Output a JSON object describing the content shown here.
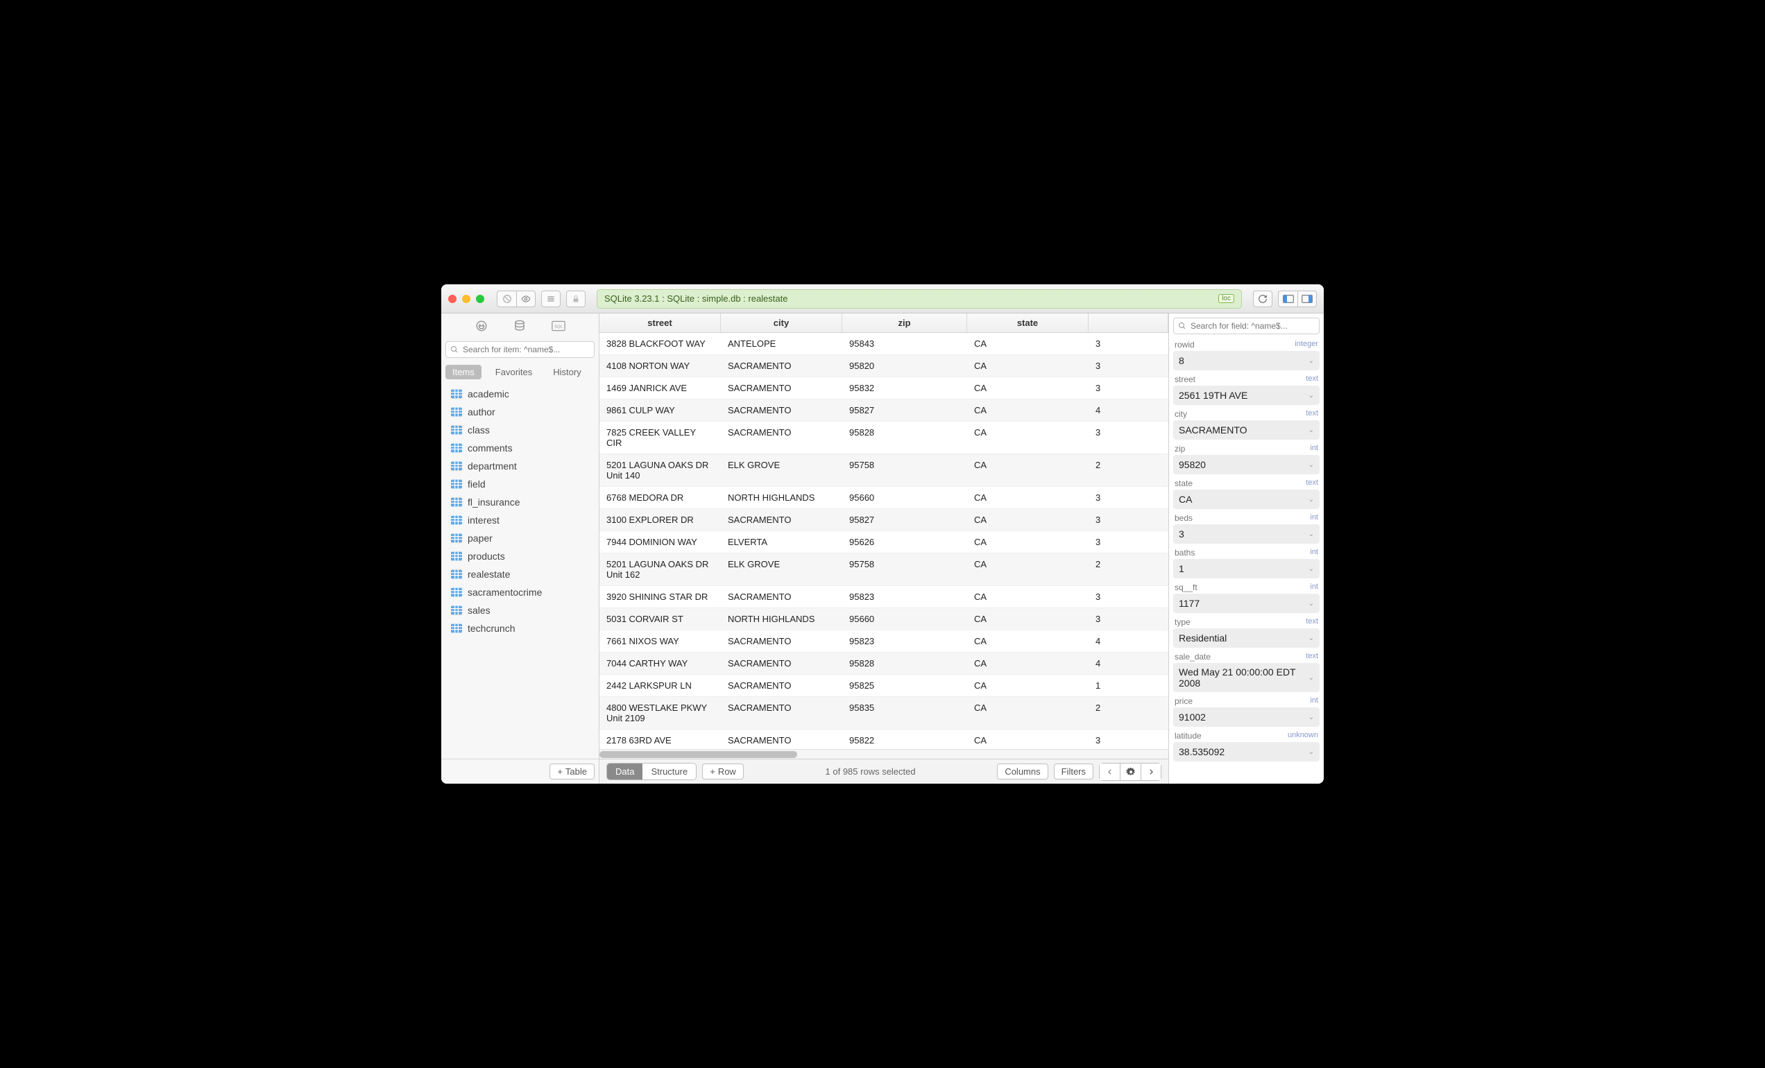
{
  "titlebar": {
    "breadcrumb": "SQLite 3.23.1 : SQLite : simple.db : realestate",
    "loc_badge": "loc"
  },
  "sidebar": {
    "search_placeholder": "Search for item: ^name$...",
    "tabs": [
      "Items",
      "Favorites",
      "History"
    ],
    "items": [
      "academic",
      "author",
      "class",
      "comments",
      "department",
      "field",
      "fl_insurance",
      "interest",
      "paper",
      "products",
      "realestate",
      "sacramentocrime",
      "sales",
      "techcrunch"
    ],
    "add_table_label": "Table"
  },
  "grid": {
    "columns": [
      "street",
      "city",
      "zip",
      "state",
      ""
    ],
    "rows": [
      {
        "street": "3828 BLACKFOOT WAY",
        "city": "ANTELOPE",
        "zip": "95843",
        "state": "CA",
        "last": "3"
      },
      {
        "street": "4108 NORTON WAY",
        "city": "SACRAMENTO",
        "zip": "95820",
        "state": "CA",
        "last": "3"
      },
      {
        "street": "1469 JANRICK AVE",
        "city": "SACRAMENTO",
        "zip": "95832",
        "state": "CA",
        "last": "3"
      },
      {
        "street": "9861 CULP WAY",
        "city": "SACRAMENTO",
        "zip": "95827",
        "state": "CA",
        "last": "4"
      },
      {
        "street": "7825 CREEK VALLEY CIR",
        "city": "SACRAMENTO",
        "zip": "95828",
        "state": "CA",
        "last": "3"
      },
      {
        "street": "5201 LAGUNA OAKS DR Unit 140",
        "city": "ELK GROVE",
        "zip": "95758",
        "state": "CA",
        "last": "2"
      },
      {
        "street": "6768 MEDORA DR",
        "city": "NORTH HIGHLANDS",
        "zip": "95660",
        "state": "CA",
        "last": "3"
      },
      {
        "street": "3100 EXPLORER DR",
        "city": "SACRAMENTO",
        "zip": "95827",
        "state": "CA",
        "last": "3"
      },
      {
        "street": "7944 DOMINION WAY",
        "city": "ELVERTA",
        "zip": "95626",
        "state": "CA",
        "last": "3"
      },
      {
        "street": "5201 LAGUNA OAKS DR Unit 162",
        "city": "ELK GROVE",
        "zip": "95758",
        "state": "CA",
        "last": "2"
      },
      {
        "street": "3920 SHINING STAR DR",
        "city": "SACRAMENTO",
        "zip": "95823",
        "state": "CA",
        "last": "3"
      },
      {
        "street": "5031 CORVAIR ST",
        "city": "NORTH HIGHLANDS",
        "zip": "95660",
        "state": "CA",
        "last": "3"
      },
      {
        "street": "7661 NIXOS WAY",
        "city": "SACRAMENTO",
        "zip": "95823",
        "state": "CA",
        "last": "4"
      },
      {
        "street": "7044 CARTHY WAY",
        "city": "SACRAMENTO",
        "zip": "95828",
        "state": "CA",
        "last": "4"
      },
      {
        "street": "2442 LARKSPUR LN",
        "city": "SACRAMENTO",
        "zip": "95825",
        "state": "CA",
        "last": "1"
      },
      {
        "street": "4800 WESTLAKE PKWY Unit 2109",
        "city": "SACRAMENTO",
        "zip": "95835",
        "state": "CA",
        "last": "2"
      },
      {
        "street": "2178 63RD AVE",
        "city": "SACRAMENTO",
        "zip": "95822",
        "state": "CA",
        "last": "3"
      }
    ]
  },
  "footer": {
    "data_tab": "Data",
    "structure_tab": "Structure",
    "add_row": "Row",
    "status": "1 of 985 rows selected",
    "columns_btn": "Columns",
    "filters_btn": "Filters"
  },
  "inspector": {
    "search_placeholder": "Search for field: ^name$...",
    "fields": [
      {
        "name": "rowid",
        "type": "integer",
        "value": "8"
      },
      {
        "name": "street",
        "type": "text",
        "value": "2561 19TH AVE"
      },
      {
        "name": "city",
        "type": "text",
        "value": "SACRAMENTO"
      },
      {
        "name": "zip",
        "type": "int",
        "value": "95820"
      },
      {
        "name": "state",
        "type": "text",
        "value": "CA"
      },
      {
        "name": "beds",
        "type": "int",
        "value": "3"
      },
      {
        "name": "baths",
        "type": "int",
        "value": "1"
      },
      {
        "name": "sq__ft",
        "type": "int",
        "value": "1177"
      },
      {
        "name": "type",
        "type": "text",
        "value": "Residential"
      },
      {
        "name": "sale_date",
        "type": "text",
        "value": "Wed May 21 00:00:00 EDT 2008"
      },
      {
        "name": "price",
        "type": "int",
        "value": "91002"
      },
      {
        "name": "latitude",
        "type": "unknown",
        "value": "38.535092"
      }
    ]
  }
}
